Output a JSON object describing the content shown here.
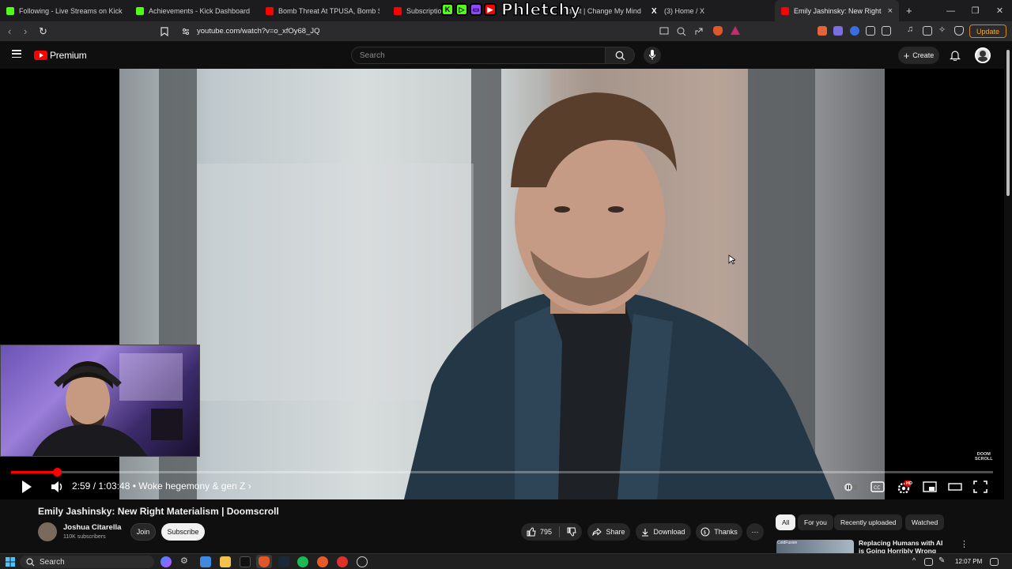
{
  "browser": {
    "tabs": [
      {
        "title": "Following - Live Streams on Kick",
        "color": "#53fc18",
        "glyph": "K"
      },
      {
        "title": "Achievements - Kick Dashboard",
        "color": "#53fc18",
        "glyph": "K"
      },
      {
        "title": "Bomb Threat At TPUSA, Bomb Squad",
        "color": "#ff0000",
        "glyph": ""
      },
      {
        "title": "Subscriptions",
        "color": "#ff0000",
        "glyph": ""
      },
      {
        "title": "ident | Change My Mind",
        "color": "#888888",
        "glyph": ""
      },
      {
        "title": "(3) Home / X",
        "color": "#ffffff",
        "glyph": "X"
      },
      {
        "title": "Emily Jashinsky: New Right Mat",
        "color": "#ff0000",
        "glyph": "",
        "active": true
      }
    ],
    "new_tab": "+",
    "close_tab": "×",
    "window_controls": [
      "—",
      "❐",
      "✕"
    ],
    "url": "youtube.com/watch?v=o_xfOy68_JQ",
    "update_label": "Update"
  },
  "overlay": {
    "brand_name": "Phletchy",
    "pills": [
      {
        "glyph": "K",
        "color": "#53fc18"
      },
      {
        "glyph": "▷",
        "color": "#53fc18"
      },
      {
        "glyph": "▭",
        "color": "#9146ff"
      },
      {
        "glyph": "▶",
        "color": "#ff0000"
      }
    ]
  },
  "youtube": {
    "brand": "Premium",
    "search_placeholder": "Search",
    "create_label": "Create",
    "player": {
      "current_time": "2:59",
      "duration": "1:03:48",
      "time_display": "2:59 / 1:03:48",
      "chapter": "• Woke hegemony & gen Z",
      "progress_fraction": 0.047,
      "watermark_line1": "DOOM",
      "watermark_line2": "SCROLL",
      "hd_badge": "HD"
    },
    "video": {
      "title": "Emily Jashinsky: New Right Materialism | Doomscroll",
      "channel": "Joshua Citarella",
      "subscribers": "110K subscribers",
      "join_label": "Join",
      "subscribe_label": "Subscribe",
      "likes": "795",
      "share_label": "Share",
      "download_label": "Download",
      "thanks_label": "Thanks",
      "more": "⋯"
    },
    "chips": [
      {
        "label": "All",
        "active": true
      },
      {
        "label": "For you"
      },
      {
        "label": "Recently uploaded"
      },
      {
        "label": "Watched"
      }
    ],
    "recommendation": {
      "title": "Replacing Humans with AI is Going Horribly Wrong",
      "thumb_label": "ColdFusion"
    }
  },
  "taskbar": {
    "search_placeholder": "Search",
    "time": "12:07 PM"
  },
  "colors": {
    "accent": "#ff0000",
    "kick": "#53fc18",
    "update_orange": "#f0a838"
  }
}
